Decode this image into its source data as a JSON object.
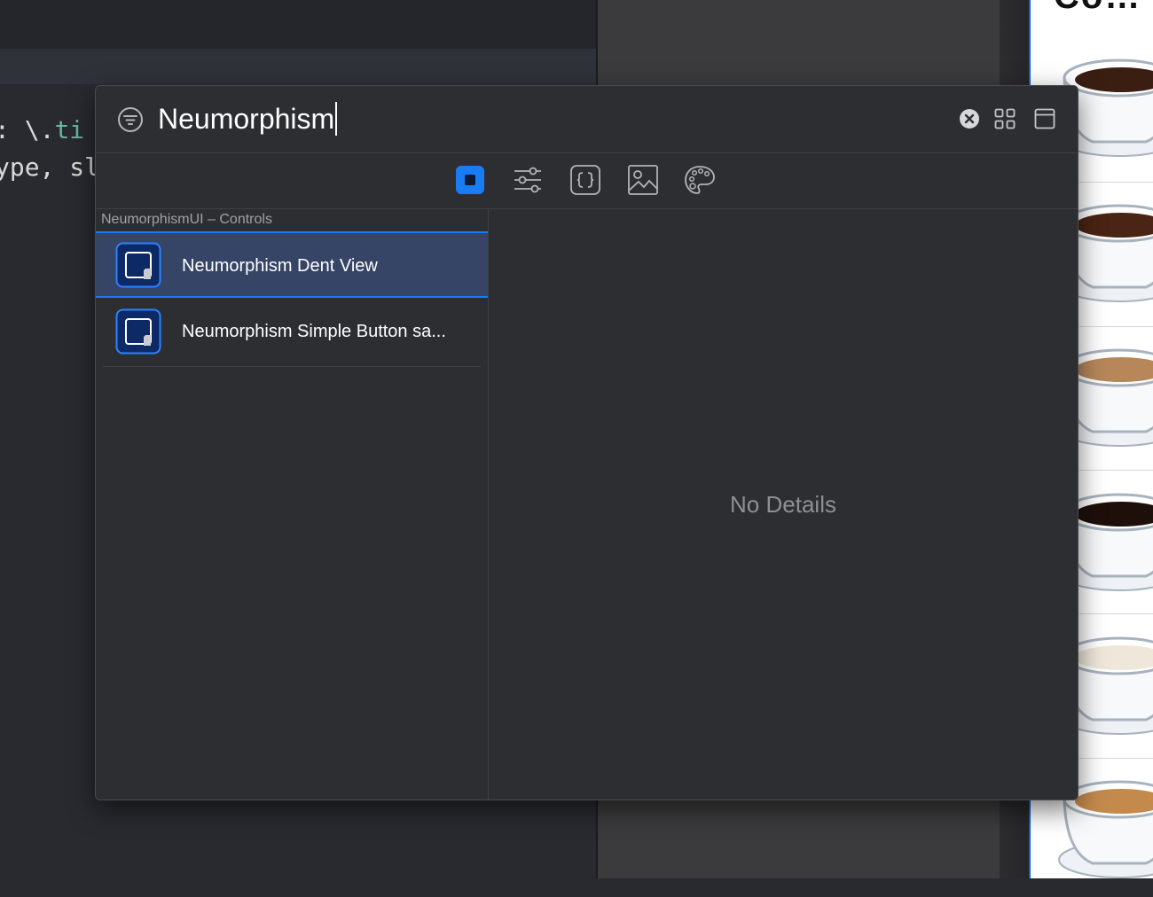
{
  "editor": {
    "code_lines": [
      {
        "prefix": ": \\.",
        "keyword": "ti"
      },
      {
        "prefix": "ype, sl",
        "keyword": ""
      }
    ]
  },
  "preview": {
    "title": "Co…"
  },
  "library": {
    "search": {
      "value": "Neumorphism",
      "filter_icon": "filter-icon",
      "clear_icon": "clear-icon"
    },
    "view_toggles": [
      "grid-view-icon",
      "window-icon"
    ],
    "tabs": [
      {
        "name": "views",
        "icon": "square-icon",
        "selected": true
      },
      {
        "name": "modifiers",
        "icon": "sliders-icon",
        "selected": false
      },
      {
        "name": "snippets",
        "icon": "braces-icon",
        "selected": false
      },
      {
        "name": "media",
        "icon": "image-icon",
        "selected": false
      },
      {
        "name": "colors",
        "icon": "palette-icon",
        "selected": false
      }
    ],
    "section_header": "NeumorphismUI – Controls",
    "items": [
      {
        "label": "Neumorphism Dent View",
        "selected": true
      },
      {
        "label": "Neumorphism Simple Button sa...",
        "selected": false
      }
    ],
    "details_placeholder": "No Details"
  },
  "colors": {
    "accent": "#1a7cf5",
    "selection": "#364466",
    "panel": "#2d2e32"
  }
}
